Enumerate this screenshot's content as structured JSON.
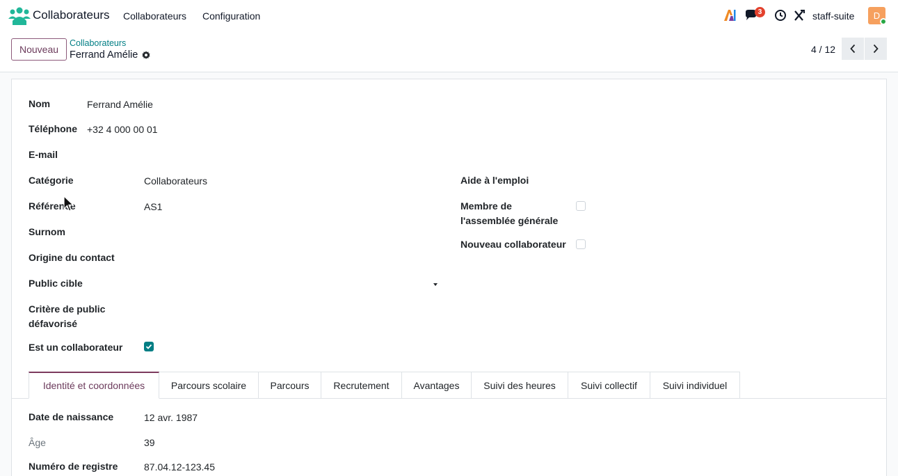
{
  "navbar": {
    "app_name": "Collaborateurs",
    "menus": [
      "Collaborateurs",
      "Configuration"
    ],
    "notification_count": "3",
    "db_name": "staff-suite",
    "avatar_initial": "D"
  },
  "control": {
    "new_button": "Nouveau",
    "breadcrumb_parent": "Collaborateurs",
    "breadcrumb_current": "Ferrand Amélie",
    "pager_value": "4 / 12"
  },
  "form": {
    "nom_label": "Nom",
    "nom_value": "Ferrand Amélie",
    "telephone_label": "Téléphone",
    "telephone_value": "+32 4 000 00 01",
    "email_label": "E-mail",
    "categorie_label": "Catégorie",
    "categorie_value": "Collaborateurs",
    "reference_label": "Référence",
    "reference_value": "AS1",
    "surnom_label": "Surnom",
    "origine_label": "Origine du contact",
    "public_cible_label": "Public cible",
    "critere_label_line1": "Critère de public",
    "critere_label_line2": "défavorisé",
    "est_collab_label": "Est un collaborateur",
    "est_collab_checked": true,
    "aide_emploi_label": "Aide à l'emploi",
    "membre_ag_label_line1": "Membre de",
    "membre_ag_label_line2": "l'assemblée générale",
    "membre_ag_checked": false,
    "nouveau_collab_label": "Nouveau collaborateur",
    "nouveau_collab_checked": false
  },
  "tabs": [
    {
      "label": "Identité et coordonnées",
      "active": true
    },
    {
      "label": "Parcours scolaire",
      "active": false
    },
    {
      "label": "Parcours",
      "active": false
    },
    {
      "label": "Recrutement",
      "active": false
    },
    {
      "label": "Avantages",
      "active": false
    },
    {
      "label": "Suivi des heures",
      "active": false
    },
    {
      "label": "Suivi collectif",
      "active": false
    },
    {
      "label": "Suivi individuel",
      "active": false
    }
  ],
  "identity": {
    "naissance_label": "Date de naissance",
    "naissance_value": "12 avr. 1987",
    "age_label": "Âge",
    "age_value": "39",
    "registre_label": "Numéro de registre",
    "registre_value": "87.04.12-123.45"
  },
  "colors": {
    "brand": "#6c3b5c",
    "accent": "#017e84",
    "badge": "#e3412d",
    "logo": "#21b799"
  }
}
